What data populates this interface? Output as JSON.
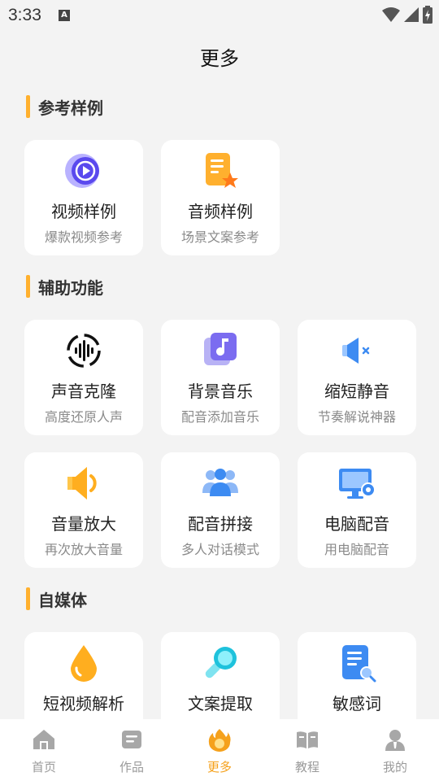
{
  "status_bar": {
    "time": "3:33",
    "badge": "A"
  },
  "page": {
    "title": "更多"
  },
  "sections": {
    "reference": {
      "label": "参考样例",
      "cards": [
        {
          "title": "视频样例",
          "sub": "爆款视频参考",
          "icon": "play-circle-icon"
        },
        {
          "title": "音频样例",
          "sub": "场景文案参考",
          "icon": "document-star-icon"
        }
      ]
    },
    "assist": {
      "label": "辅助功能",
      "cards": [
        {
          "title": "声音克隆",
          "sub": "高度还原人声",
          "icon": "sound-wave-icon"
        },
        {
          "title": "背景音乐",
          "sub": "配音添加音乐",
          "icon": "music-note-icon"
        },
        {
          "title": "缩短静音",
          "sub": "节奏解说神器",
          "icon": "speaker-mute-icon"
        },
        {
          "title": "音量放大",
          "sub": "再次放大音量",
          "icon": "speaker-loud-icon"
        },
        {
          "title": "配音拼接",
          "sub": "多人对话模式",
          "icon": "people-group-icon"
        },
        {
          "title": "电脑配音",
          "sub": "用电脑配音",
          "icon": "computer-gear-icon"
        }
      ]
    },
    "media": {
      "label": "自媒体",
      "cards": [
        {
          "title": "短视频解析",
          "icon": "water-drop-icon"
        },
        {
          "title": "文案提取",
          "icon": "magnifier-icon"
        },
        {
          "title": "敏感词",
          "icon": "document-search-icon"
        }
      ]
    }
  },
  "tabs": [
    {
      "label": "首页",
      "icon": "home-icon",
      "active": false
    },
    {
      "label": "作品",
      "icon": "works-icon",
      "active": false
    },
    {
      "label": "更多",
      "icon": "flame-icon",
      "active": true
    },
    {
      "label": "教程",
      "icon": "book-icon",
      "active": false
    },
    {
      "label": "我的",
      "icon": "user-icon",
      "active": false
    }
  ],
  "colors": {
    "accent": "#f5a11c",
    "section_bar": "#ffb02e",
    "background": "#f3f3f3"
  }
}
